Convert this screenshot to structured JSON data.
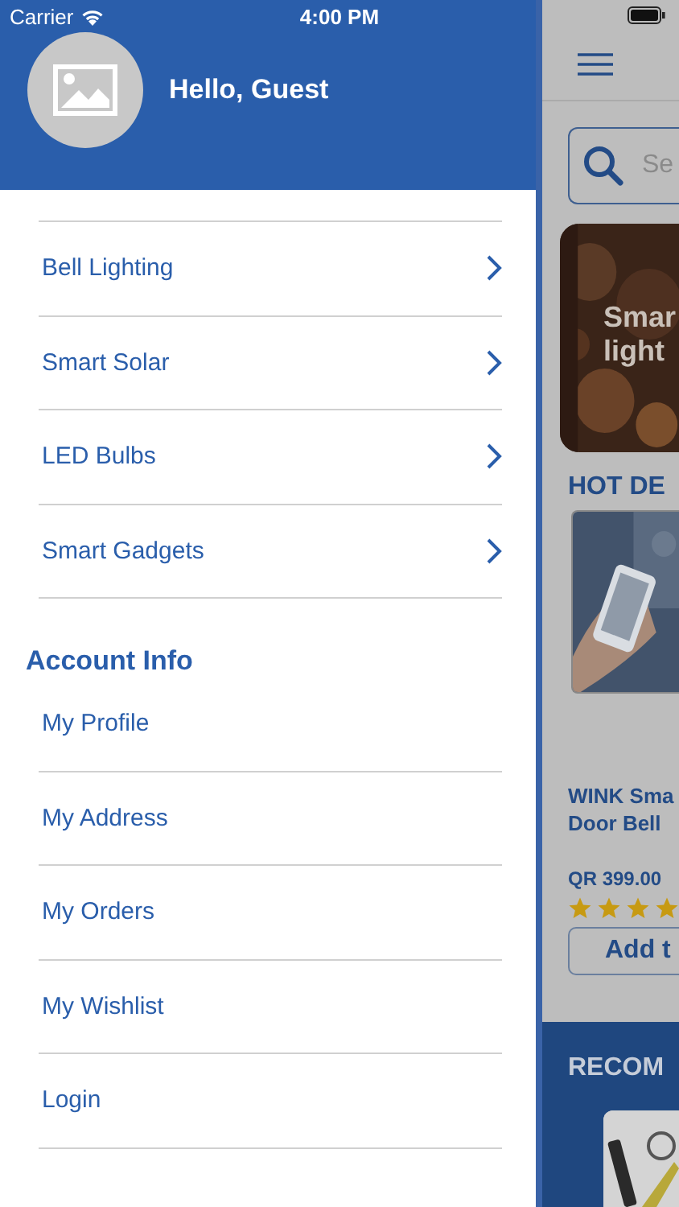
{
  "status_bar": {
    "carrier": "Carrier",
    "time": "4:00 PM"
  },
  "drawer": {
    "greeting": "Hello, Guest",
    "categories": [
      {
        "label": "Bell Lighting"
      },
      {
        "label": "Smart Solar"
      },
      {
        "label": "LED Bulbs"
      },
      {
        "label": "Smart Gadgets"
      }
    ],
    "account_heading": "Account Info",
    "account_items": [
      {
        "label": "My Profile"
      },
      {
        "label": "My Address"
      },
      {
        "label": "My Orders"
      },
      {
        "label": "My Wishlist"
      },
      {
        "label": "Login"
      }
    ]
  },
  "main": {
    "search": {
      "placeholder": "Se"
    },
    "banner": {
      "title_lines": [
        "Smar",
        "light"
      ]
    },
    "hot_deals_heading": "HOT DE",
    "product": {
      "name_lines": [
        "WINK Sma",
        "Door Bell"
      ],
      "price": "QR 399.00",
      "stars": 4,
      "button": "Add t"
    },
    "recommended_heading": "RECOM"
  }
}
